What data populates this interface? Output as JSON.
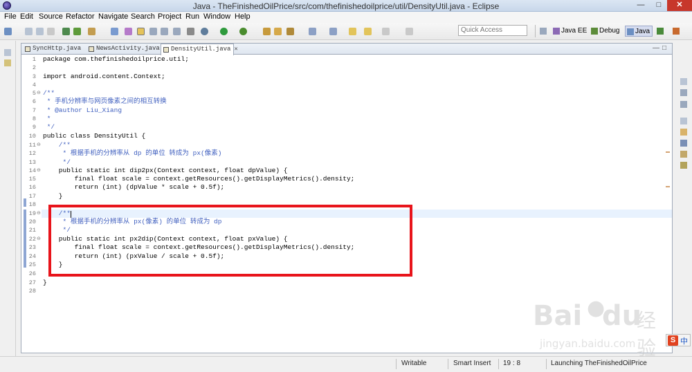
{
  "window": {
    "title": "Java - TheFinishedOilPrice/src/com/thefinishedoilprice/util/DensityUtil.java - Eclipse"
  },
  "menu": [
    "File",
    "Edit",
    "Source",
    "Refactor",
    "Navigate",
    "Search",
    "Project",
    "Run",
    "Window",
    "Help"
  ],
  "toolbar": {
    "quick_access_placeholder": "Quick Access",
    "perspectives": [
      {
        "label": "Java EE",
        "active": false
      },
      {
        "label": "Debug",
        "active": false
      },
      {
        "label": "Java",
        "active": true
      }
    ]
  },
  "editor": {
    "tabs": [
      {
        "label": "SyncHttp.java",
        "active": false
      },
      {
        "label": "NewsActivity.java",
        "active": false
      },
      {
        "label": "DensityUtil.java",
        "active": true,
        "close": "✕"
      }
    ],
    "line_numbers": [
      "1",
      "2",
      "3",
      "4",
      "5",
      "6",
      "7",
      "8",
      "9",
      "10",
      "11",
      "12",
      "13",
      "14",
      "15",
      "16",
      "17",
      "18",
      "19",
      "20",
      "21",
      "22",
      "23",
      "24",
      "25",
      "26",
      "27",
      "28"
    ],
    "lines": [
      "package com.thefinishedoilprice.util;",
      "",
      "import android.content.Context;",
      "",
      "/**",
      " * 手机分辨率与网页像素之间的相互转换",
      " * @author Liu_Xiang",
      " *",
      " */",
      "public class DensityUtil {",
      "    /**",
      "     * 根据手机的分辨率从 dp 的单位 转成为 px(像素)",
      "     */",
      "    public static int dip2px(Context context, float dpValue) {",
      "        final float scale = context.getResources().getDisplayMetrics().density;",
      "        return (int) (dpValue * scale + 0.5f);",
      "    }",
      "",
      "    /**",
      "     * 根据手机的分辨率从 px(像素) 的单位 转成为 dp",
      "     */",
      "    public static int px2dip(Context context, float pxValue) {",
      "        final float scale = context.getResources().getDisplayMetrics().density;",
      "        return (int) (pxValue / scale + 0.5f);",
      "    }",
      "",
      "}",
      ""
    ]
  },
  "status": {
    "mode": "Writable",
    "insert": "Smart Insert",
    "position": "19 : 8",
    "progress": "Launching TheFinishedOilPrice"
  },
  "watermark": {
    "brand": "Bai",
    "brand2": "du",
    "label": "经验",
    "url": "jingyan.baidu.com"
  },
  "ime": {
    "logo": "S",
    "lang": "中"
  },
  "colors": {
    "highlight_box": "#e8141b",
    "keyword": "#7f0055",
    "comment": "#3f5fbf",
    "field": "#0000c0"
  }
}
